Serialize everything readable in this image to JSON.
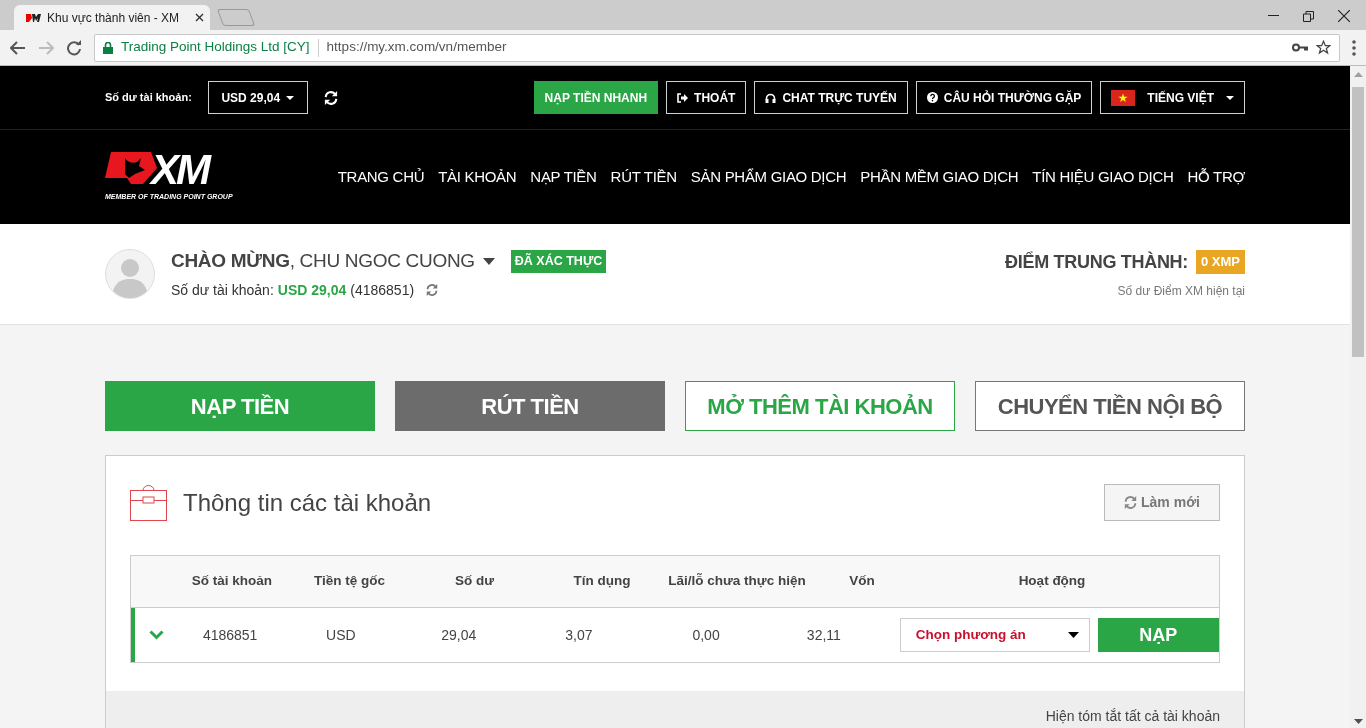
{
  "browser": {
    "tab_title": "Khu vực thành viên - XM",
    "site_identity": "Trading Point Holdings Ltd [CY]",
    "url": "https://my.xm.com/vn/member"
  },
  "top_bar": {
    "balance_label": "Số dư tài khoản:",
    "balance_value": "USD 29,04",
    "buttons": [
      {
        "label": "NẠP TIỀN NHANH",
        "kind": "filled"
      },
      {
        "label": "THOÁT",
        "kind": "outlined"
      },
      {
        "label": "CHAT TRỰC TUYẾN",
        "kind": "outlined"
      },
      {
        "label": "CÂU HỎI THƯỜNG GẶP",
        "kind": "outlined"
      },
      {
        "label": "TIẾNG VIỆT",
        "kind": "dropdown"
      }
    ]
  },
  "logo": {
    "text": "XM",
    "tagline": "MEMBER OF TRADING POINT GROUP"
  },
  "nav": {
    "items": [
      "TRANG CHỦ",
      "TÀI KHOẢN",
      "NẠP TIỀN",
      "RÚT TIỀN",
      "SẢN PHẨM GIAO DỊCH",
      "PHẦN MỀM GIAO DỊCH",
      "TÍN HIỆU GIAO DỊCH",
      "HỖ TRỢ"
    ]
  },
  "welcome": {
    "greeting": "**CHÀO MỪNG**, CHU NGOC CUONG",
    "verified_badge": "ĐÃ XÁC THỰC",
    "balance_label": "Số dư tài khoản:",
    "balance_value": "USD 29,04",
    "account_number": "(4186851)",
    "loyalty_label": "ĐIỂM TRUNG THÀNH:",
    "loyalty_badge": "0 XMP",
    "loyalty_caption": "Số dư Điểm XM hiện tại"
  },
  "actions": [
    {
      "label": "NẠP TIỀN",
      "kind": "primary"
    },
    {
      "label": "RÚT TIỀN",
      "kind": "secondary"
    },
    {
      "label": "MỞ THÊM TÀI KHOẢN",
      "kind": "outline-primary"
    },
    {
      "label": "CHUYỂN TIỀN NỘI BỘ",
      "kind": "outline-secondary"
    }
  ],
  "accounts_panel": {
    "title": "Thông tin các tài khoản",
    "refresh_button": "Làm mới",
    "table": {
      "columns": [
        "Số tài khoản",
        "Tiền tệ gốc",
        "Số dư",
        "Tín dụng",
        "Lãi/lỗ chưa thực hiện",
        "Vốn",
        "Hoạt động"
      ],
      "rows": [
        {
          "expanded": false,
          "cells": [
            "4186851",
            "USD",
            "29,04",
            "3,07",
            "0,00",
            "32,11"
          ],
          "action_select": {
            "placeholder": "Chọn phương án"
          },
          "action_button": "NẠP"
        }
      ]
    },
    "summary_link": "Hiện tóm tắt tất cả tài khoản"
  }
}
